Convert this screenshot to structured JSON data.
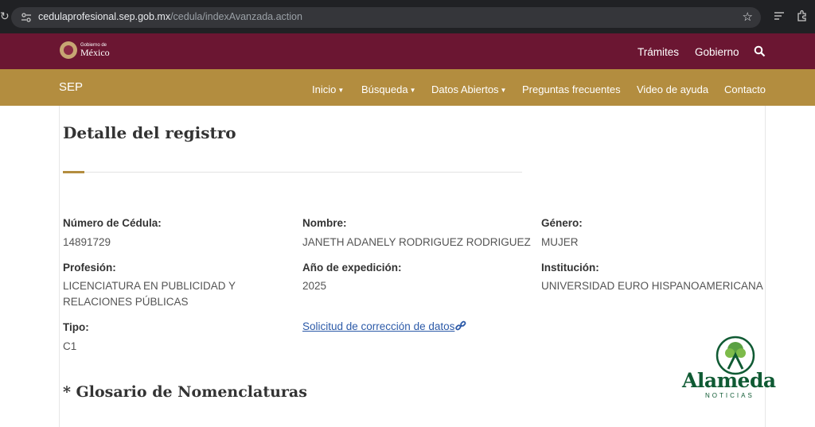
{
  "browser": {
    "url_domain": "cedulaprofesional.sep.gob.mx",
    "url_path": "/cedula/indexAvanzada.action"
  },
  "gob_header": {
    "logo_small": "Gobierno de",
    "logo_big": "México",
    "links": [
      "Trámites",
      "Gobierno"
    ]
  },
  "sep_nav": {
    "title": "SEP",
    "items": [
      {
        "label": "Inicio",
        "dropdown": true
      },
      {
        "label": "Búsqueda",
        "dropdown": true
      },
      {
        "label": "Datos Abiertos",
        "dropdown": true
      },
      {
        "label": "Preguntas frecuentes",
        "dropdown": false
      },
      {
        "label": "Video de ayuda",
        "dropdown": false
      },
      {
        "label": "Contacto",
        "dropdown": false
      }
    ]
  },
  "page": {
    "title": "Detalle del registro",
    "fields": {
      "cedula": {
        "label": "Número de Cédula:",
        "value": "14891729"
      },
      "nombre": {
        "label": "Nombre:",
        "value": "JANETH ADANELY RODRIGUEZ RODRIGUEZ"
      },
      "genero": {
        "label": "Género:",
        "value": "MUJER"
      },
      "profesion": {
        "label": "Profesión:",
        "value_line1": "LICENCIATURA EN PUBLICIDAD Y",
        "value_line2": "RELACIONES PÚBLICAS"
      },
      "anio": {
        "label": "Año de expedición:",
        "value": "2025"
      },
      "institucion": {
        "label": "Institución:",
        "value": "UNIVERSIDAD EURO HISPANOAMERICANA"
      },
      "tipo": {
        "label": "Tipo:",
        "value": "C1"
      }
    },
    "correction_link": "Solicitud de corrección de datos",
    "glossary_title": "* Glosario de Nomenclaturas"
  },
  "watermark": {
    "name": "Alameda",
    "sub": "NOTICIAS"
  },
  "colors": {
    "gob_maroon": "#6b1632",
    "sep_gold": "#b38d3f",
    "link_blue": "#2c5aa8",
    "watermark_green": "#0f5a33"
  }
}
